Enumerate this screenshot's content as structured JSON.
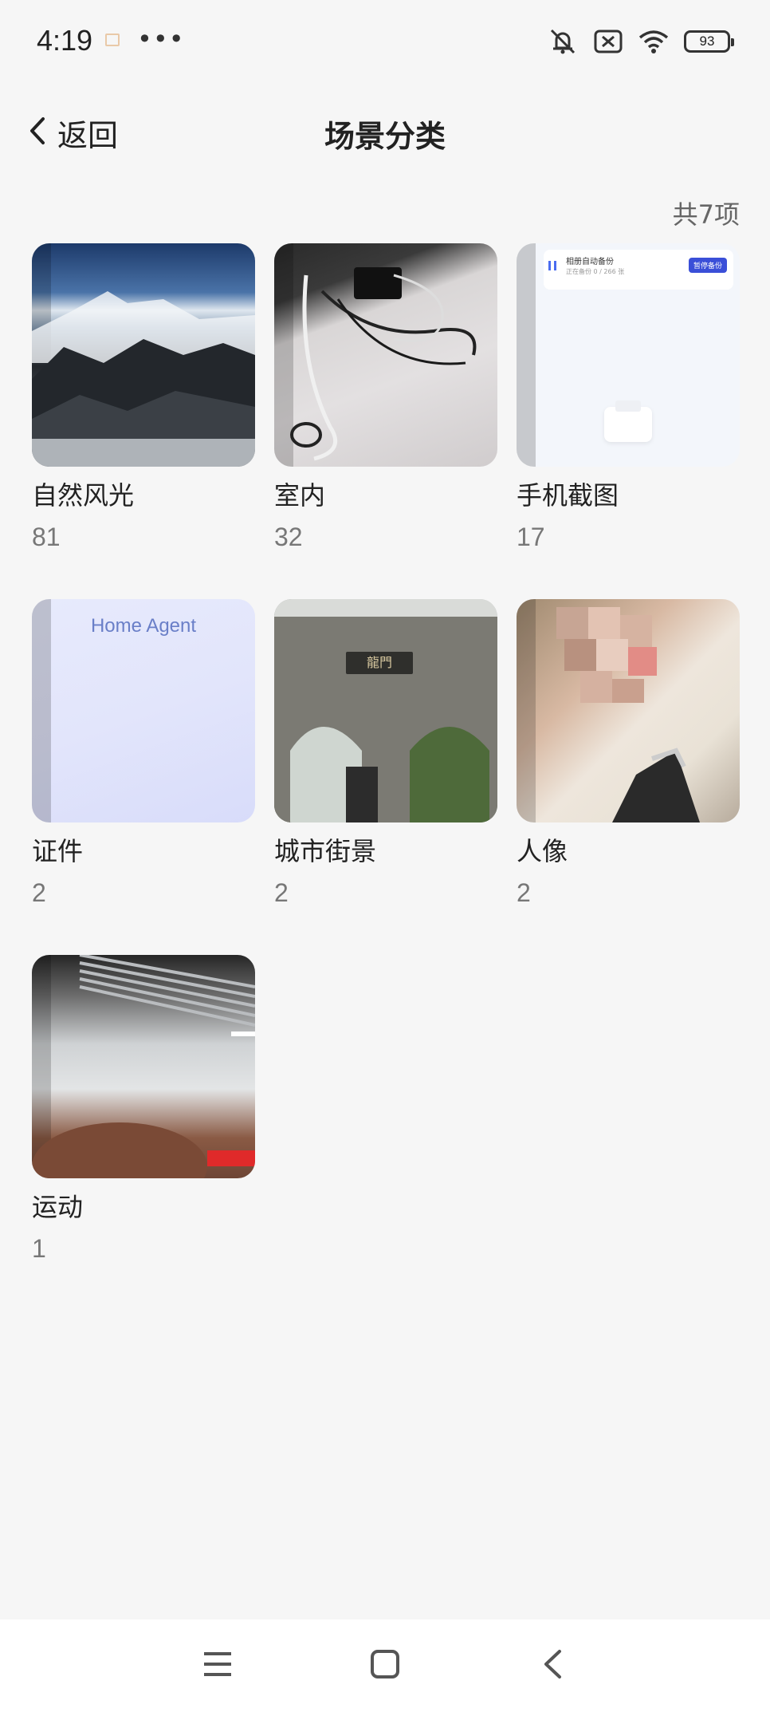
{
  "status_bar": {
    "time": "4:19",
    "dots": "•••",
    "battery": "93"
  },
  "header": {
    "back_label": "返回",
    "title": "场景分类"
  },
  "count_label": "共7项",
  "categories": [
    {
      "name": "自然风光",
      "count": "81"
    },
    {
      "name": "室内",
      "count": "32"
    },
    {
      "name": "手机截图",
      "count": "17"
    },
    {
      "name": "证件",
      "count": "2"
    },
    {
      "name": "城市街景",
      "count": "2"
    },
    {
      "name": "人像",
      "count": "2"
    },
    {
      "name": "运动",
      "count": "1"
    }
  ],
  "thumb_texts": {
    "screen_header": "相册自动备份",
    "screen_sub": "正在备份 0 / 266 张",
    "screen_button": "暂停备份",
    "doc_text": "Home Agent",
    "gate_plaque": "龍門"
  },
  "icons": {
    "status": [
      "book-icon",
      "mute-icon",
      "no-sim-icon",
      "wifi-icon",
      "battery-icon"
    ],
    "header": [
      "chevron-left-icon"
    ],
    "nav": [
      "menu-icon",
      "home-icon",
      "back-icon"
    ]
  }
}
